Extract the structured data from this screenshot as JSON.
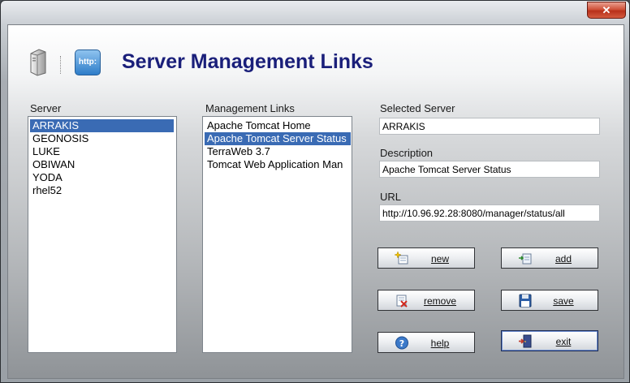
{
  "window": {
    "close_label": "✕"
  },
  "header": {
    "title": "Server Management Links",
    "http_icon_text": "http:"
  },
  "server_list": {
    "label": "Server",
    "items": [
      "ARRAKIS",
      "GEONOSIS",
      "LUKE",
      "OBIWAN",
      "YODA",
      "rhel52"
    ],
    "selected": "ARRAKIS"
  },
  "links_list": {
    "label": "Management Links",
    "items": [
      "Apache Tomcat Home",
      "Apache Tomcat Server Status",
      "TerraWeb 3.7",
      "Tomcat Web Application Man"
    ],
    "selected": "Apache Tomcat Server Status"
  },
  "details": {
    "selected_server_label": "Selected Server",
    "selected_server_value": "ARRAKIS",
    "description_label": "Description",
    "description_value": "Apache Tomcat Server Status",
    "url_label": "URL",
    "url_value": "http://10.96.92.28:8080/manager/status/all"
  },
  "buttons": {
    "new": "new",
    "add": "add",
    "remove": "remove",
    "save": "save",
    "help": "help",
    "exit": "exit"
  },
  "icons": {
    "server": "server-tower-icon",
    "http": "http-icon",
    "new": "new-document-icon",
    "add": "add-link-icon",
    "remove": "remove-document-icon",
    "save": "floppy-disk-icon",
    "help": "question-mark-icon",
    "exit": "exit-door-icon"
  },
  "colors": {
    "title": "#1a1f7a",
    "selection": "#3a6bb4",
    "close_button": "#c8432c"
  }
}
